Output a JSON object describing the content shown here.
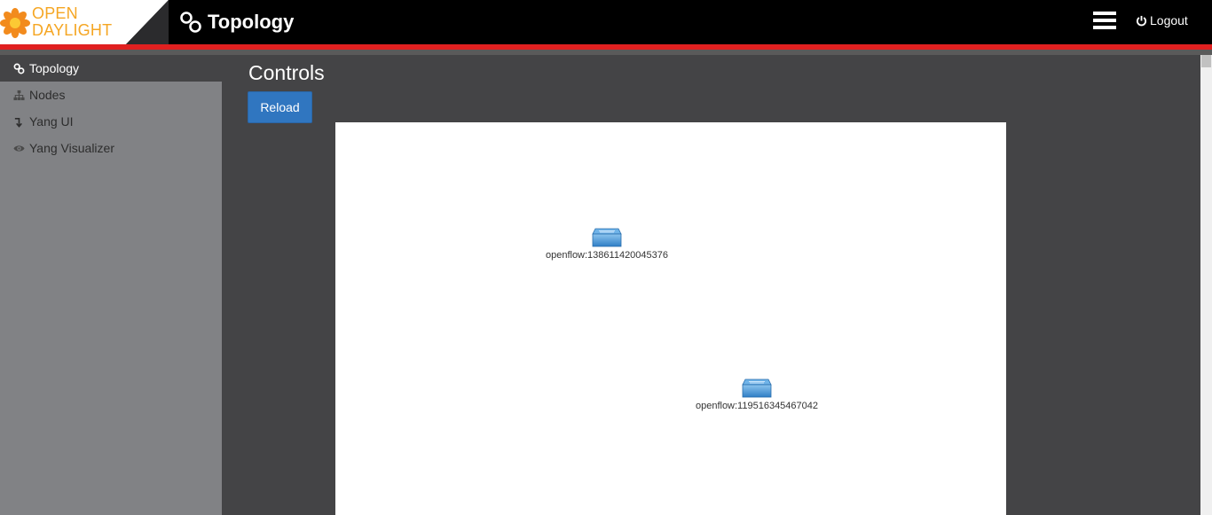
{
  "header": {
    "logo_line1": "OPEN",
    "logo_line2": "DAYLIGHT",
    "title": "Topology",
    "logout_label": "Logout",
    "accent_color": "#e02020",
    "logo_color": "#f5a623"
  },
  "sidebar": {
    "items": [
      {
        "label": "Topology",
        "icon": "link-icon",
        "active": true
      },
      {
        "label": "Nodes",
        "icon": "sitemap-icon",
        "active": false
      },
      {
        "label": "Yang UI",
        "icon": "arrow-down-icon",
        "active": false
      },
      {
        "label": "Yang Visualizer",
        "icon": "eye-icon",
        "active": false
      }
    ]
  },
  "main": {
    "heading": "Controls",
    "reload_label": "Reload",
    "button_color": "#3076c0"
  },
  "topology": {
    "nodes": [
      {
        "label": "openflow:138611420045376",
        "icon": "switch-icon"
      },
      {
        "label": "openflow:119516345467042",
        "icon": "switch-icon"
      }
    ]
  }
}
